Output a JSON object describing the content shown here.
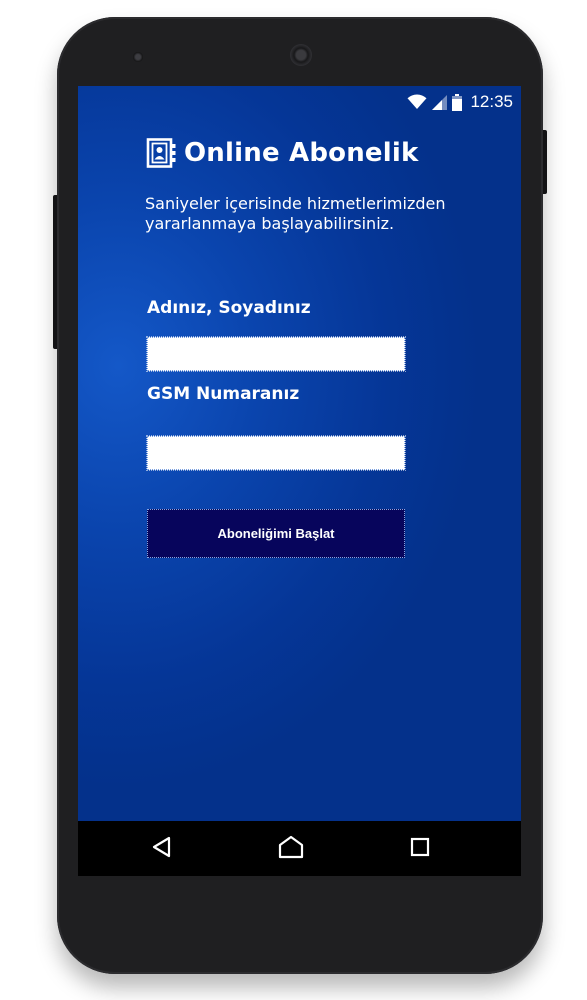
{
  "statusbar": {
    "time": "12:35",
    "icons": [
      "wifi-icon",
      "cell-signal-icon",
      "battery-icon"
    ]
  },
  "app": {
    "icon": "address-book-icon",
    "title": "Online Abonelik",
    "subtitle": "Saniyeler içerisinde hizmetlerimizden yararlanmaya başlayabilirsiniz."
  },
  "form": {
    "name_label": "Adınız, Soyadınız",
    "name_value": "",
    "gsm_label": "GSM Numaranız",
    "gsm_value": "",
    "submit_label": "Aboneliğimi Başlat"
  },
  "navbar": {
    "icons": [
      "back-icon",
      "home-icon",
      "recent-apps-icon"
    ]
  },
  "colors": {
    "background": "#04318b",
    "button": "#07055c",
    "text": "#ffffff"
  }
}
